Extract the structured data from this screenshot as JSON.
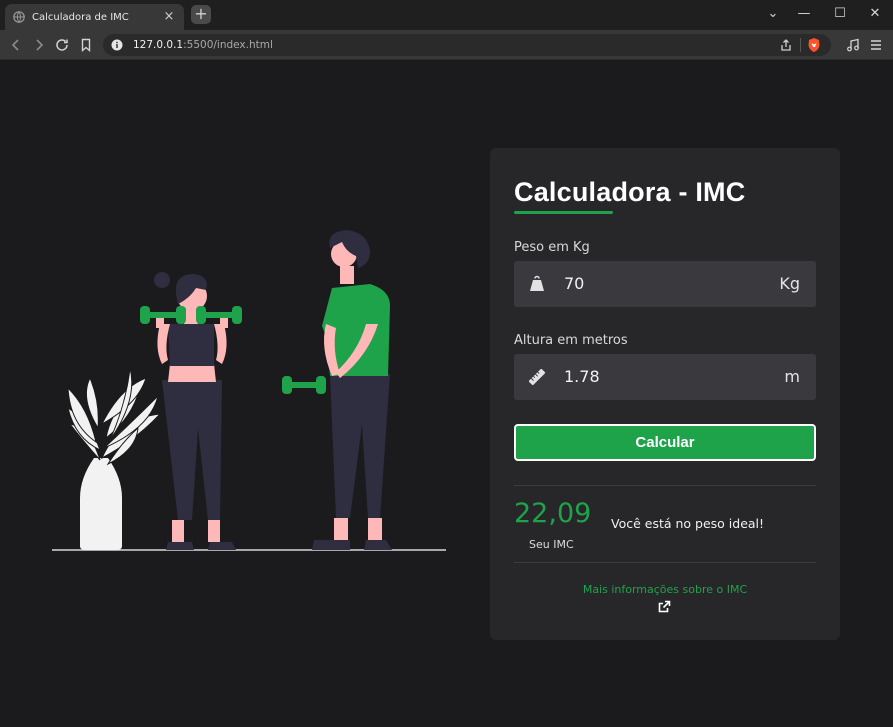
{
  "browser": {
    "tab_title": "Calculadora de IMC",
    "tab_close": "×",
    "new_tab": "+",
    "url_host": "127.0.0.1",
    "url_rest": ":5500/index.html",
    "window_controls": {
      "dropdown": "⌄",
      "minimize": "—",
      "maximize": "☐",
      "close": "✕"
    }
  },
  "card": {
    "title": "Calculadora - IMC",
    "weight": {
      "label": "Peso em Kg",
      "value": "70",
      "unit": "Kg",
      "icon": "weight-icon"
    },
    "height": {
      "label": "Altura em metros",
      "value": "1.78",
      "unit": "m",
      "icon": "ruler-icon"
    },
    "button_label": "Calcular",
    "result": {
      "value": "22,09",
      "label": "Seu IMC",
      "message": "Você está no peso ideal!"
    },
    "more_info": "Mais informações sobre o IMC"
  },
  "colors": {
    "accent": "#1ea34a",
    "background": "#1b1b1d",
    "card": "#272729",
    "input": "#3a3a3e"
  }
}
